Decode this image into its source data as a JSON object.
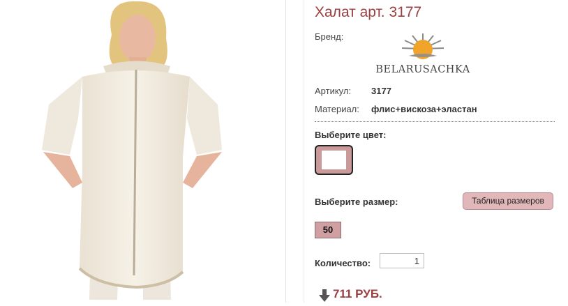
{
  "product": {
    "title": "Халат арт. 3177",
    "photo_alt": "Халат арт. 3177"
  },
  "brand": {
    "label": "Бренд:",
    "logo_text": "BELARUSACHKA",
    "logo_icon": "sun-icon",
    "colors": {
      "sun": "#f0a52a",
      "rays": "#8a8a8a"
    }
  },
  "specs": [
    {
      "label": "Артикул:",
      "value": "3177"
    },
    {
      "label": "Материал:",
      "value": "флис+вискоза+эластан"
    }
  ],
  "color_select": {
    "label": "Выберите цвет:",
    "selected_swatch": "#ffffff",
    "swatch_border": "#c99a99"
  },
  "size_select": {
    "label": "Выберите размер:",
    "size_table_button": "Таблица размеров",
    "sizes": [
      "50"
    ]
  },
  "quantity": {
    "label": "Количество:",
    "value": "1"
  },
  "price": {
    "text": "711 РУБ.",
    "icon": "arrow-down-icon",
    "color": "#9a3f3f"
  }
}
